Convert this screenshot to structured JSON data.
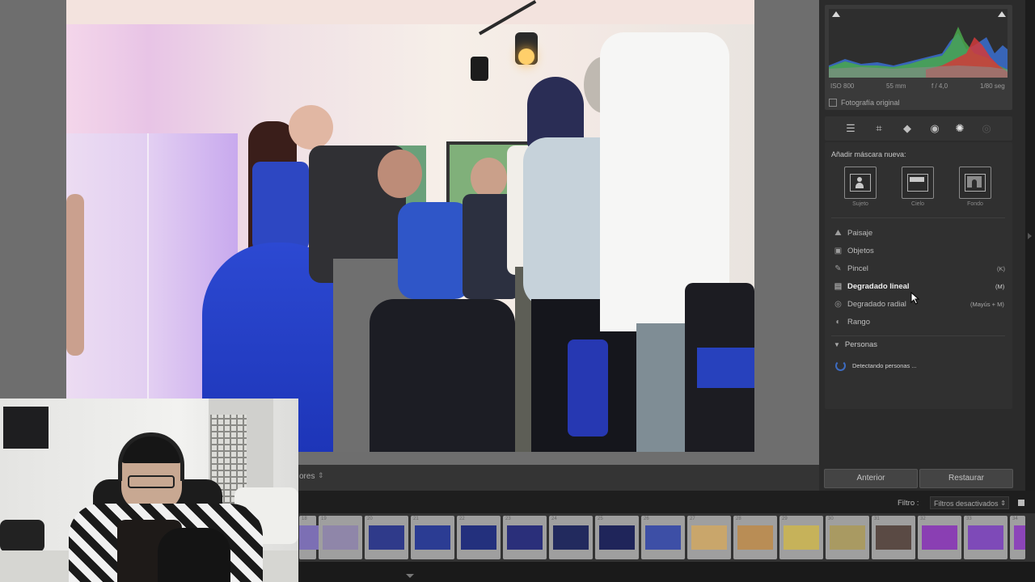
{
  "photo": {
    "description_hidden": ""
  },
  "histogram": {
    "exif": [
      "ISO 800",
      "55 mm",
      "f / 4,0",
      "1/80 seg"
    ],
    "original_label": "Fotografía original"
  },
  "tools": [
    "sliders-icon",
    "crop-icon",
    "eraser-icon",
    "redeye-icon",
    "mask-icon",
    "preset-icon"
  ],
  "masks": {
    "title": "Añadir máscara nueva:",
    "buttons": [
      {
        "label": "Sujeto"
      },
      {
        "label": "Cielo"
      },
      {
        "label": "Fondo"
      }
    ],
    "items": [
      {
        "label": "Paisaje",
        "shortcut": ""
      },
      {
        "label": "Objetos",
        "shortcut": ""
      },
      {
        "label": "Pincel",
        "shortcut": "(K)"
      },
      {
        "label": "Degradado lineal",
        "shortcut": "(M)"
      },
      {
        "label": "Degradado radial",
        "shortcut": "(Mayús + M)"
      },
      {
        "label": "Rango",
        "shortcut": ""
      }
    ],
    "people_header": "Personas",
    "detecting": "Detectando personas ..."
  },
  "bottom_buttons": {
    "previous": "Anterior",
    "reset": "Restaurar"
  },
  "toolbar": {
    "sort_label": "ores"
  },
  "filmstrip": {
    "filter_label": "Filtro :",
    "filter_value": "Filtros desactivados",
    "thumbnails": [
      {
        "num": "18",
        "color": "#7c6fb4"
      },
      {
        "num": "19",
        "color": "#8f86a9"
      },
      {
        "num": "20",
        "color": "#2f3a8a"
      },
      {
        "num": "21",
        "color": "#2b3c93"
      },
      {
        "num": "22",
        "color": "#23307d"
      },
      {
        "num": "23",
        "color": "#2a2f7a"
      },
      {
        "num": "24",
        "color": "#222a5e"
      },
      {
        "num": "25",
        "color": "#1f255a"
      },
      {
        "num": "26",
        "color": "#3d4fa6"
      },
      {
        "num": "27",
        "color": "#c9a66b"
      },
      {
        "num": "28",
        "color": "#b98d55"
      },
      {
        "num": "29",
        "color": "#c6b25a"
      },
      {
        "num": "30",
        "color": "#a99a62"
      },
      {
        "num": "31",
        "color": "#5a4a44"
      },
      {
        "num": "32",
        "color": "#8a3fb3"
      },
      {
        "num": "33",
        "color": "#7e4ab8"
      },
      {
        "num": "34",
        "color": "#8c45b9"
      }
    ]
  }
}
